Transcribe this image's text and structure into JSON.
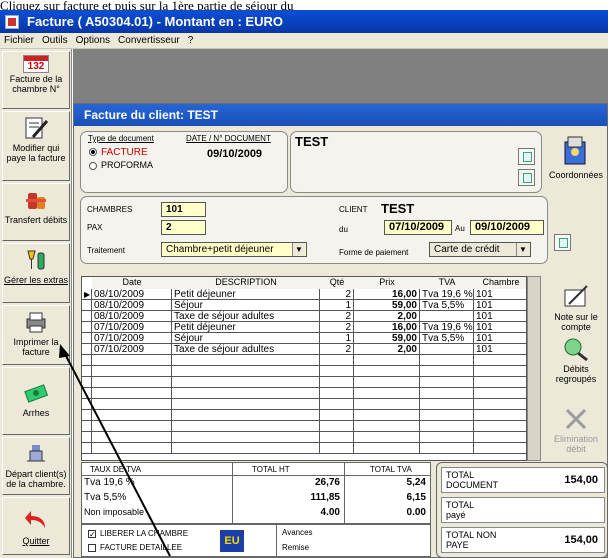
{
  "caption": "Cliquez sur facture et puis sur la 1ère partie de séjour du",
  "window": {
    "title": "Facture ( A50304.01)  - Montant en : EURO"
  },
  "menu": [
    "Fichier",
    "Outils",
    "Options",
    "Convertisseur",
    "?"
  ],
  "left_toolbar": {
    "room_number": "132",
    "items": [
      {
        "label": "Facture de la chambre N°",
        "icon": "invoice-room-icon"
      },
      {
        "label": "Modifier qui paye la facture",
        "icon": "edit-payer-icon"
      },
      {
        "label": "Transfert débits",
        "icon": "transfer-debits-icon"
      },
      {
        "label": "Gérer les extras",
        "icon": "extras-icon"
      },
      {
        "label": "Imprimer la facture",
        "icon": "printer-icon"
      },
      {
        "label": "Arrhes",
        "icon": "money-icon"
      },
      {
        "label": "Départ client(s) de la chambre.",
        "icon": "departure-icon"
      },
      {
        "label": "Quitter",
        "icon": "quit-arrow-icon"
      }
    ]
  },
  "dialog": {
    "title": "Facture du client: TEST",
    "doc_type_label": "Type de document",
    "date_doc_label": "DATE / N° DOCUMENT",
    "facture_label": "FACTURE",
    "proforma_label": "PROFORMA",
    "doc_date": "09/10/2009",
    "client_name_box": "TEST",
    "coord_label": "Coordonnées",
    "chambres_label": "CHAMBRES",
    "chambres_value": "101",
    "pax_label": "PAX",
    "pax_value": "2",
    "traitement_label": "Traitement",
    "traitement_value": "Chambre+petit déjeuner",
    "client_label": "CLIENT",
    "client_value": "TEST",
    "du_label": "du",
    "date_from": "07/10/2009",
    "au_label": "Au",
    "date_to": "09/10/2009",
    "payment_label": "Forme de paiement",
    "payment_value": "Carte de crédit"
  },
  "table": {
    "headers": [
      "Date",
      "DESCRIPTION",
      "Qté",
      "Prix",
      "TVA",
      "Chambre"
    ],
    "rows": [
      {
        "date": "08/10/2009",
        "desc": "Petit déjeuner",
        "qty": "2",
        "price": "16,00",
        "tva": "Tva 19,6 %",
        "room": "101"
      },
      {
        "date": "08/10/2009",
        "desc": "Séjour",
        "qty": "1",
        "price": "59,00",
        "tva": "Tva  5,5%",
        "room": "101"
      },
      {
        "date": "08/10/2009",
        "desc": "Taxe de séjour adultes",
        "qty": "2",
        "price": "2,00",
        "tva": "",
        "room": "101"
      },
      {
        "date": "07/10/2009",
        "desc": "Petit déjeuner",
        "qty": "2",
        "price": "16,00",
        "tva": "Tva 19,6 %",
        "room": "101"
      },
      {
        "date": "07/10/2009",
        "desc": "Séjour",
        "qty": "1",
        "price": "59,00",
        "tva": "Tva  5,5%",
        "room": "101"
      },
      {
        "date": "07/10/2009",
        "desc": "Taxe de séjour adultes",
        "qty": "2",
        "price": "2,00",
        "tva": "",
        "room": "101"
      }
    ]
  },
  "right_toolbar": [
    {
      "label": "Note sur le compte",
      "icon": "note-icon"
    },
    {
      "label": "Débits regroupés",
      "icon": "grouped-debits-icon"
    },
    {
      "label": "Elimination débit",
      "icon": "delete-debit-icon"
    }
  ],
  "summary": {
    "h_rate": "TAUX DE TVA",
    "h_ht": "TOTAL HT",
    "h_tva": "TOTAL TVA",
    "rows": [
      {
        "rate": "Tva 19,6 %",
        "ht": "26,76",
        "tva": "5,24"
      },
      {
        "rate": "Tva 5,5%",
        "ht": "111,85",
        "tva": "6,15"
      },
      {
        "rate": "Non imposable",
        "ht": "4.00",
        "tva": "0.00"
      }
    ],
    "liberer": "LIBERER LA CHAMBRE",
    "detaillee": "FACTURE DETAILLEE",
    "eu": "EU",
    "avances": "Avances",
    "remise": "Remise"
  },
  "totals": {
    "doc_label": "TOTAL DOCUMENT",
    "doc_value": "154,00",
    "paye_label": "TOTAL payé",
    "nonpaye_label": "TOTAL NON PAYE",
    "nonpaye_value": "154,00"
  },
  "colors": {
    "title_blue": "#0a4fd6",
    "facture_red": "#cc0000",
    "highlight_yellow": "#ffffc8"
  }
}
